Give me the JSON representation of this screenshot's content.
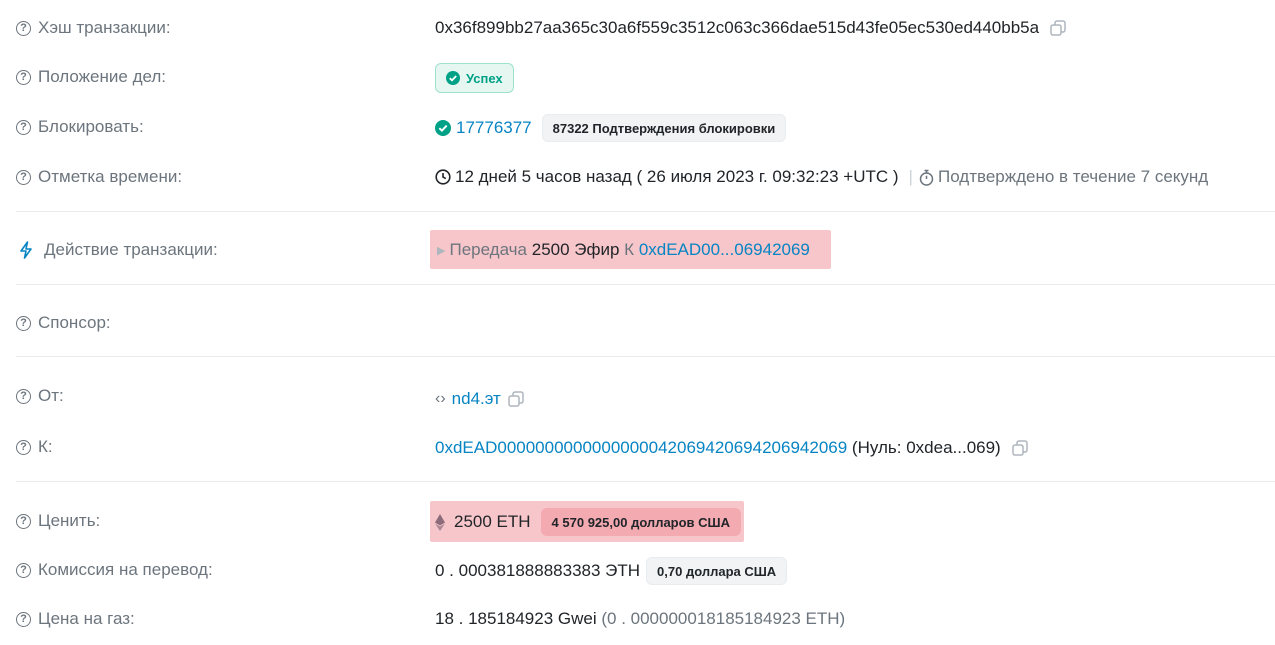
{
  "rows": {
    "hash": {
      "label": "Хэш транзакции:",
      "value": "0x36f899bb27aa365c30a6f559c3512c063c366dae515d43fe05ec530ed440bb5a"
    },
    "status": {
      "label": "Положение дел:",
      "badge": "Успех"
    },
    "block": {
      "label": "Блокировать:",
      "number": "17776377",
      "confirmations": "87322 Подтверждения блокировки"
    },
    "timestamp": {
      "label": "Отметка времени:",
      "ago": "12 дней 5 часов назад ( 26 июля 2023 г. 09:32:23 +UTC )",
      "separator": "|",
      "confirmed": "Подтверждено в течение 7 секунд"
    },
    "action": {
      "label": "Действие транзакции:",
      "verb": "Передача",
      "amount": "2500 Эфир",
      "to_word": "К",
      "address": "0xdEAD00...06942069"
    },
    "sponsor": {
      "label": "Спонсор:"
    },
    "from": {
      "label": "От:",
      "value": "nd4.эт"
    },
    "to": {
      "label": "К:",
      "address": "0xdEAD0000000000000000042069420694206942069",
      "note": "(Нуль: 0xdea...069)"
    },
    "value": {
      "label": "Ценить:",
      "eth": "2500 ETH",
      "usd": "4 570 925,00 долларов США"
    },
    "fee": {
      "label": "Комиссия на перевод:",
      "eth": "0 . 000381888883383 ЭТН",
      "usd": "0,70 доллара США"
    },
    "gas": {
      "label": "Цена на газ:",
      "gwei": "18 . 185184923 Gwei",
      "eth": "(0 . 000000018185184923 ETH)"
    }
  },
  "colors": {
    "link": "#0784c3",
    "success": "#00a186",
    "highlight": "#f7c6ca",
    "muted": "#6c757d"
  }
}
